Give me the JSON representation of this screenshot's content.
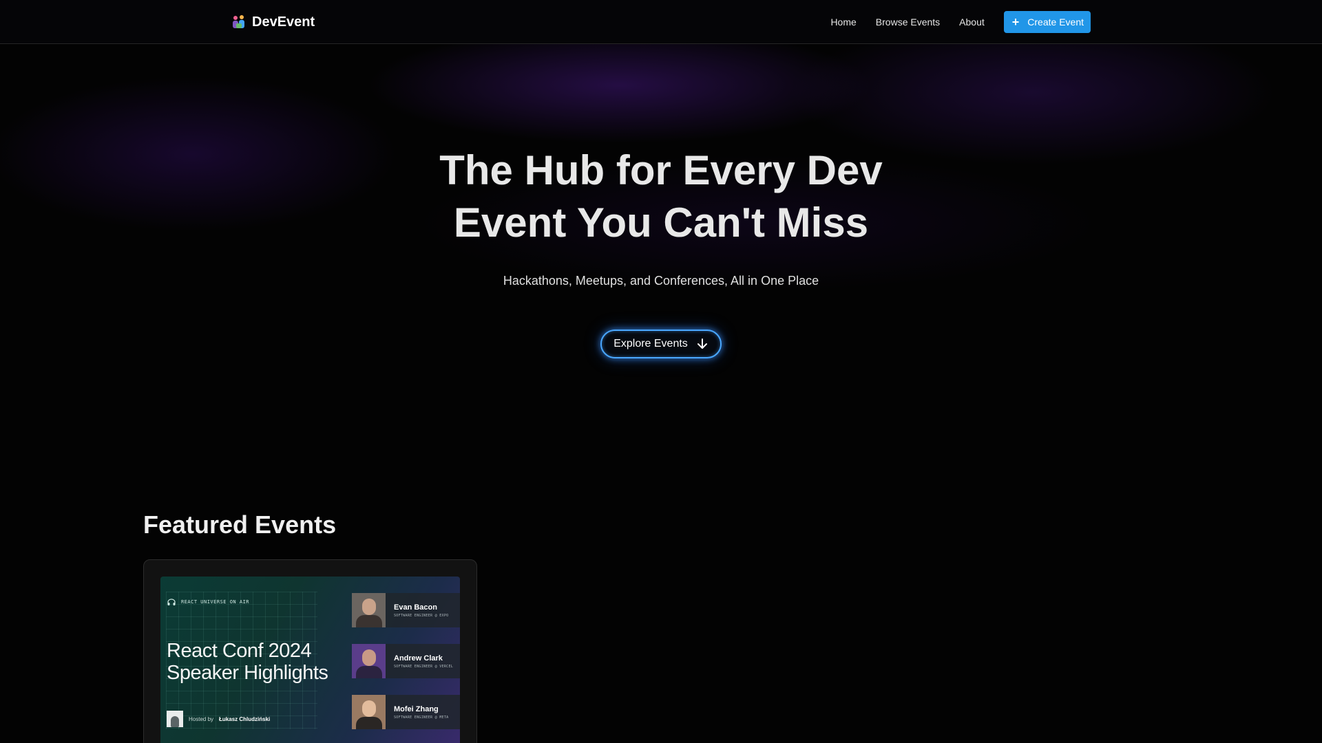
{
  "nav": {
    "brand": "DevEvent",
    "links": [
      "Home",
      "Browse Events",
      "About"
    ],
    "create_label": "Create Event",
    "accent": "#2196e8"
  },
  "hero": {
    "title_line1": "The Hub for Every Dev",
    "title_line2": "Event You Can't Miss",
    "subtitle": "Hackathons, Meetups, and Conferences, All in One Place",
    "cta_label": "Explore Events",
    "cta_icon": "arrow-down-icon"
  },
  "featured": {
    "title": "Featured Events",
    "events": [
      {
        "poster_tag": "REACT UNIVERSE ON AIR",
        "poster_title_line1": "React Conf 2024",
        "poster_title_line2": "Speaker Highlights",
        "host_prefix": "Hosted by",
        "host_name": "Łukasz Chludziński",
        "speakers": [
          {
            "name": "Evan Bacon",
            "role": "SOFTWARE ENGINEER @ EXPO"
          },
          {
            "name": "Andrew Clark",
            "role": "SOFTWARE ENGINEER @ VERCEL"
          },
          {
            "name": "Mofei Zhang",
            "role": "SOFTWARE ENGINEER @ META"
          }
        ]
      }
    ]
  }
}
